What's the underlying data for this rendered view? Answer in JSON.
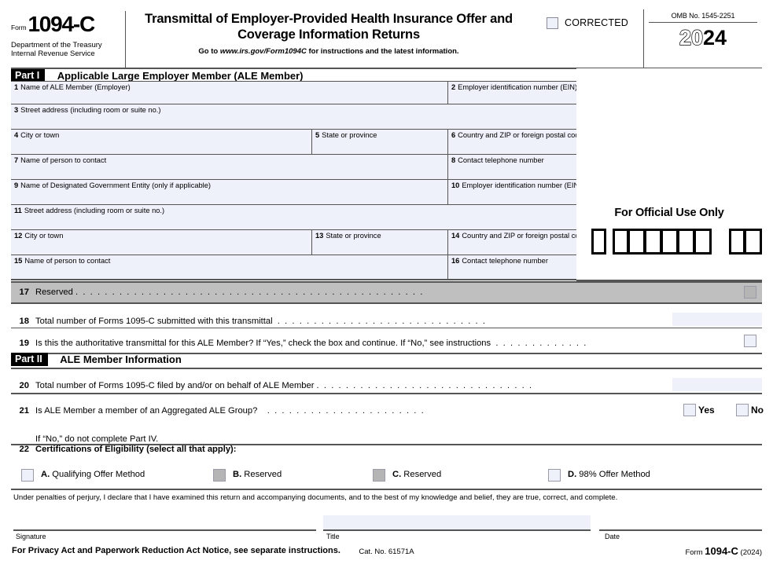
{
  "header": {
    "form_word": "Form",
    "form_number": "1094-C",
    "department_line1": "Department of the Treasury",
    "department_line2": "Internal Revenue Service",
    "title_line1": "Transmittal of Employer-Provided Health Insurance Offer and",
    "title_line2": "Coverage Information Returns",
    "goto_prefix": "Go to",
    "goto_url": "www.irs.gov/Form1094C",
    "goto_suffix": "for instructions and the latest information.",
    "corrected_label": "CORRECTED",
    "omb": "OMB No. 1545-2251",
    "year_hollow": "20",
    "year_solid": "24"
  },
  "part1": {
    "tag": "Part I",
    "title": "Applicable Large Employer Member (ALE Member)",
    "fields": [
      {
        "num": "1",
        "label": "Name of ALE Member (Employer)",
        "value": ""
      },
      {
        "num": "2",
        "label": "Employer identification number (EIN)",
        "value": ""
      },
      {
        "num": "3",
        "label": "Street address (including room or suite no.)",
        "value": ""
      },
      {
        "num": "4",
        "label": "City or town",
        "value": ""
      },
      {
        "num": "5",
        "label": "State or province",
        "value": ""
      },
      {
        "num": "6",
        "label": "Country and ZIP or foreign postal code",
        "value": ""
      },
      {
        "num": "7",
        "label": "Name of person to contact",
        "value": ""
      },
      {
        "num": "8",
        "label": "Contact telephone number",
        "value": ""
      },
      {
        "num": "9",
        "label": "Name of Designated Government Entity (only if applicable)",
        "value": ""
      },
      {
        "num": "10",
        "label": "Employer identification number (EIN)",
        "value": ""
      },
      {
        "num": "11",
        "label": "Street address (including room or suite no.)",
        "value": ""
      },
      {
        "num": "12",
        "label": "City or town",
        "value": ""
      },
      {
        "num": "13",
        "label": "State or province",
        "value": ""
      },
      {
        "num": "14",
        "label": "Country and ZIP or foreign postal code",
        "value": ""
      },
      {
        "num": "15",
        "label": "Name of person to contact",
        "value": ""
      },
      {
        "num": "16",
        "label": "Contact telephone number",
        "value": ""
      }
    ],
    "official_use_title": "For Official Use Only",
    "line17": {
      "num": "17",
      "text": "Reserved",
      "value": ""
    },
    "line18": {
      "num": "18",
      "text": "Total number of Forms 1095-C submitted with this transmittal",
      "value": ""
    },
    "line19": {
      "num": "19",
      "text": "Is this the authoritative transmittal for this ALE Member? If “Yes,” check the box and continue. If “No,” see instructions",
      "value": ""
    }
  },
  "part2": {
    "tag": "Part II",
    "title": "ALE Member Information",
    "line20": {
      "num": "20",
      "text": "Total number of Forms 1095-C filed by and/or on behalf of ALE Member",
      "value": ""
    },
    "line21": {
      "num": "21",
      "text": "Is ALE Member a member of an Aggregated ALE Group?",
      "subtext": "If “No,” do not complete Part IV.",
      "yes_label": "Yes",
      "no_label": "No"
    },
    "line22": {
      "num": "22",
      "text": "Certifications of Eligibility (select all that apply):",
      "options": [
        {
          "letter": "A.",
          "label": "Qualifying Offer Method",
          "reserved": false
        },
        {
          "letter": "B.",
          "label": "Reserved",
          "reserved": true
        },
        {
          "letter": "C.",
          "label": "Reserved",
          "reserved": true
        },
        {
          "letter": "D.",
          "label": "98% Offer Method",
          "reserved": false
        }
      ]
    }
  },
  "signature": {
    "perjury": "Under penalties of perjury, I declare that I have examined this return and accompanying documents, and to the best of my knowledge and belief, they are true, correct, and complete.",
    "signature_label": "Signature",
    "title_label": "Title",
    "date_label": "Date",
    "title_value": ""
  },
  "footer": {
    "privacy_notice": "For Privacy Act and Paperwork Reduction Act Notice, see separate instructions.",
    "cat_no": "Cat. No. 61571A",
    "form_word": "Form",
    "form_number": "1094-C",
    "form_year": "(2024)"
  },
  "colors": {
    "field_fill": "#eef0fa",
    "reserved_gray": "#b5b5b5",
    "band_gray": "#bfbfbf",
    "rule": "#555555"
  }
}
